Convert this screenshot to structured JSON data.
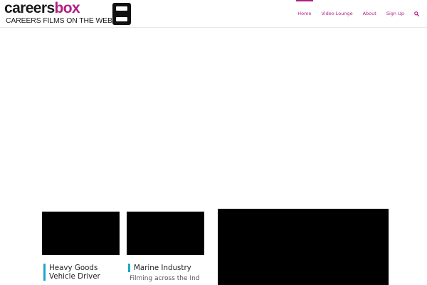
{
  "logo": {
    "word_part1": "careers",
    "word_part2": "box",
    "tagline": "CAREERS FILMS ON THE WEB"
  },
  "nav": {
    "items": [
      {
        "label": "Home",
        "active": true
      },
      {
        "label": "Video Lounge",
        "active": false
      },
      {
        "label": "About",
        "active": false
      },
      {
        "label": "Sign Up",
        "active": false
      }
    ],
    "search_icon": "search-icon"
  },
  "cards": [
    {
      "title": "Heavy Goods Vehicle Driver",
      "subtitle": ""
    },
    {
      "title": "Marine Industry",
      "subtitle": "Filming across the Ind"
    }
  ],
  "colors": {
    "brand": "#b01f83",
    "accent": "#20a6c8",
    "text": "#222222",
    "player": "#000000"
  }
}
